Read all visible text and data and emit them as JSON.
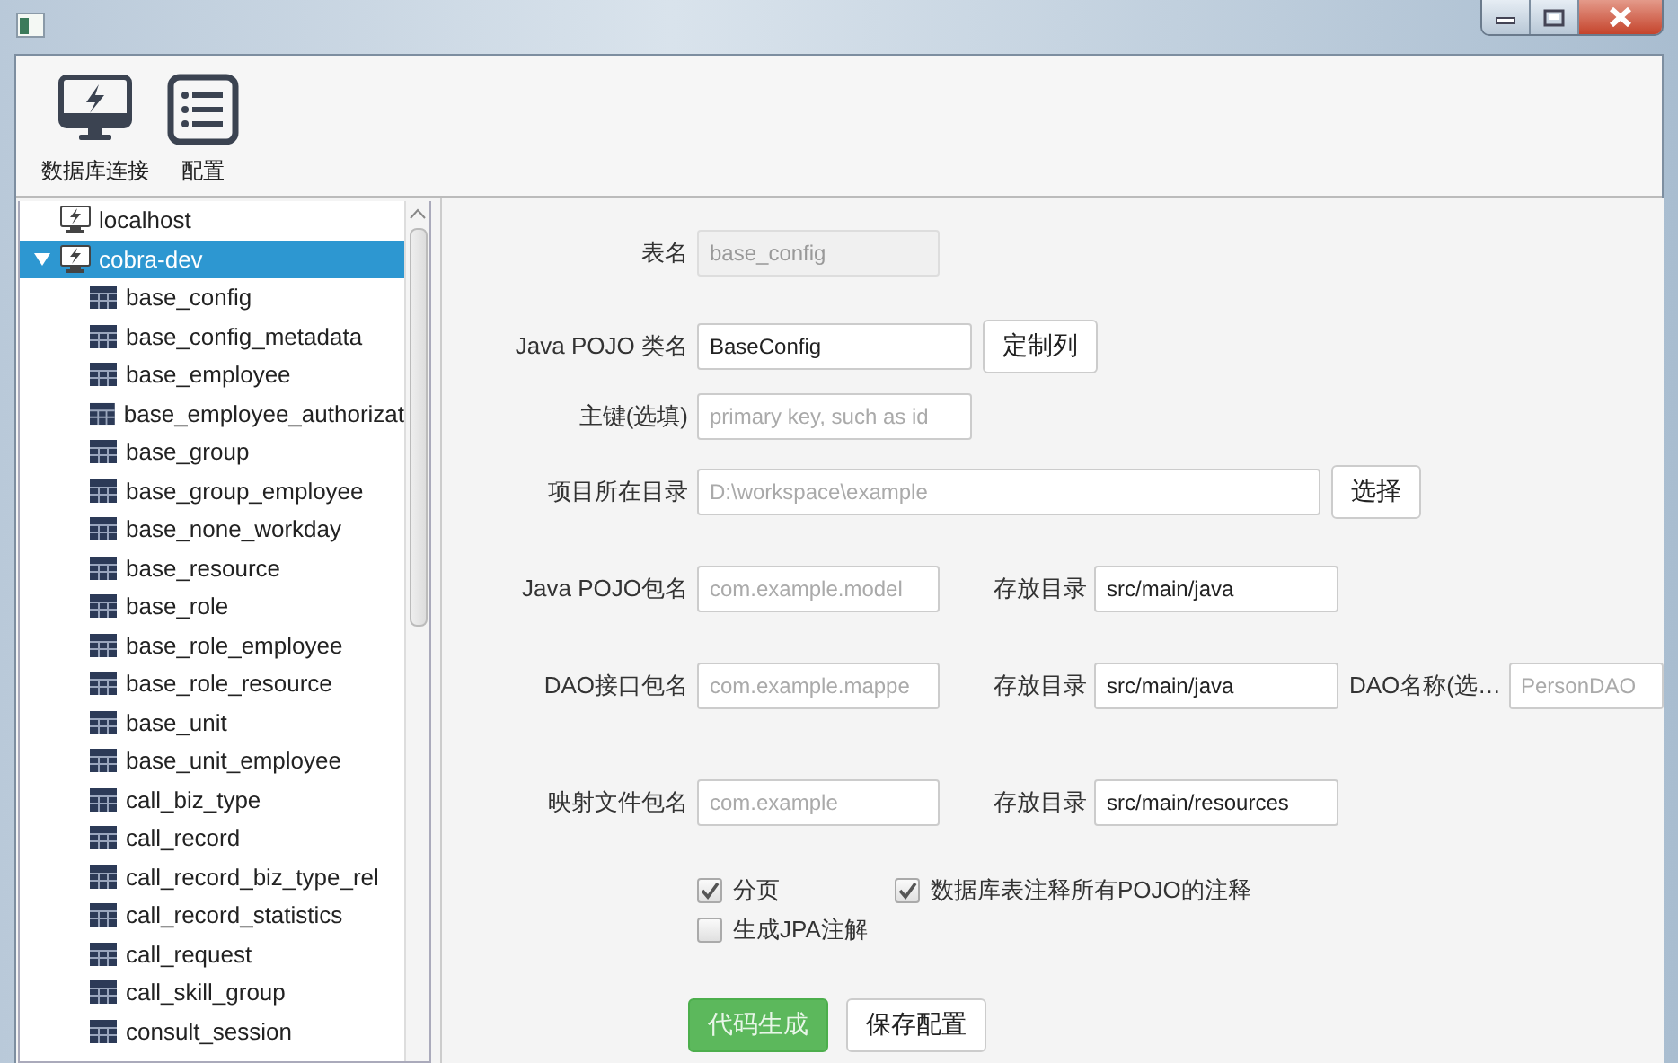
{
  "toolbar": [
    {
      "label": "数据库连接"
    },
    {
      "label": "配置"
    }
  ],
  "tree": [
    {
      "label": "localhost",
      "selected": false
    },
    {
      "label": "cobra-dev",
      "expanded": true,
      "selected": true,
      "children": [
        {
          "label": "base_config",
          "selected": false
        },
        {
          "label": "base_config_metadata",
          "selected": false
        },
        {
          "label": "base_employee",
          "selected": false
        },
        {
          "label": "base_employee_authorizat",
          "selected": false
        },
        {
          "label": "base_group",
          "selected": false
        },
        {
          "label": "base_group_employee",
          "selected": false
        },
        {
          "label": "base_none_workday",
          "selected": false
        },
        {
          "label": "base_resource",
          "selected": false
        },
        {
          "label": "base_role",
          "selected": false
        },
        {
          "label": "base_role_employee",
          "selected": false
        },
        {
          "label": "base_role_resource",
          "selected": false
        },
        {
          "label": "base_unit",
          "selected": false
        },
        {
          "label": "base_unit_employee",
          "selected": false
        },
        {
          "label": "call_biz_type",
          "selected": false
        },
        {
          "label": "call_record",
          "selected": false
        },
        {
          "label": "call_record_biz_type_rel",
          "selected": false
        },
        {
          "label": "call_record_statistics",
          "selected": false
        },
        {
          "label": "call_request",
          "selected": false
        },
        {
          "label": "call_skill_group",
          "selected": false
        },
        {
          "label": "consult_session",
          "selected": false
        }
      ]
    }
  ],
  "form": {
    "rows": [
      {
        "label": "表名",
        "field": {
          "value": "base_config",
          "disabled": true
        }
      },
      {
        "label": "Java POJO 类名",
        "field": {
          "value": "BaseConfig",
          "disabled": false
        },
        "button": "定制列"
      },
      {
        "label": "主键(选填)",
        "field": {
          "placeholder": "primary key, such as id",
          "disabled": false
        }
      },
      {
        "label": "项目所在目录",
        "field": {
          "placeholder": "D:\\workspace\\example",
          "disabled": false
        },
        "button": "选择"
      },
      {
        "label": "Java POJO包名",
        "field": {
          "placeholder": "com.example.model",
          "disabled": false
        },
        "extras": [
          {
            "label": "存放目录",
            "field": {
              "value": "src/main/java",
              "disabled": false
            }
          }
        ]
      },
      {
        "label": "DAO接口包名",
        "field": {
          "placeholder": "com.example.mappe",
          "disabled": false
        },
        "extras": [
          {
            "label": "存放目录",
            "field": {
              "value": "src/main/java",
              "disabled": false
            }
          },
          {
            "label": "DAO名称(选…",
            "field": {
              "placeholder": "PersonDAO",
              "disabled": false
            }
          }
        ]
      },
      {
        "label": "映射文件包名",
        "field": {
          "placeholder": "com.example",
          "disabled": false
        },
        "extras": [
          {
            "label": "存放目录",
            "field": {
              "value": "src/main/resources",
              "disabled": false
            }
          }
        ]
      }
    ],
    "checkboxes": [
      {
        "label": "分页",
        "checked": true
      },
      {
        "label": "数据库表注释所有POJO的注释",
        "checked": true
      },
      {
        "label": "生成JPA注解",
        "checked": false
      }
    ],
    "buttons": [
      {
        "label": "代码生成",
        "kind": "primary"
      },
      {
        "label": "保存配置",
        "kind": "default"
      }
    ]
  }
}
